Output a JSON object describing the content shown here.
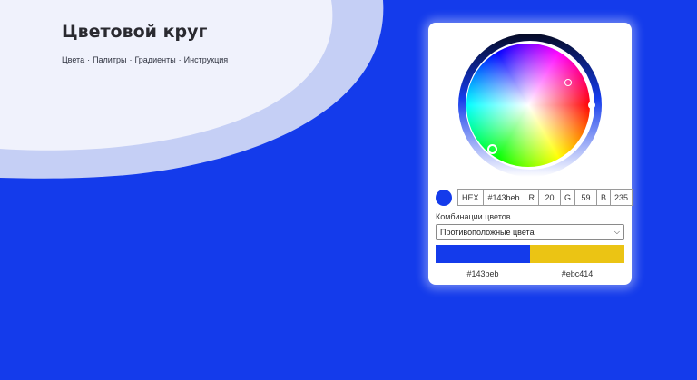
{
  "colors": {
    "background": "#143beb",
    "selected": "#143beb",
    "complement": "#ebc414"
  },
  "header": {
    "title": "Цветовой круг",
    "nav": [
      "Цвета",
      "Палитры",
      "Градиенты",
      "Инструкция"
    ],
    "separator": "·"
  },
  "picker": {
    "hex_label": "HEX",
    "hex_value": "#143beb",
    "r_label": "R",
    "r_value": "20",
    "g_label": "G",
    "g_value": "59",
    "b_label": "B",
    "b_value": "235"
  },
  "combos": {
    "label": "Комбинации цветов",
    "selected": "Противоположные цвета",
    "palette": [
      {
        "hex": "#143beb"
      },
      {
        "hex": "#ebc414"
      }
    ]
  }
}
